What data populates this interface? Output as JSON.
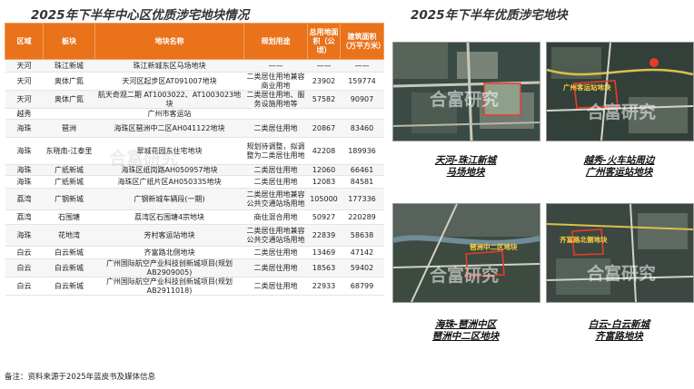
{
  "left_title": "2025年下半年中心区优质涉宅地块情况",
  "right_title": "2025年下半年优质涉宅地块",
  "table": {
    "headers": [
      "区域",
      "板块",
      "地块名称",
      "规划用途",
      "总用地面积（公顷）",
      "建筑面积（万平方米）"
    ],
    "rows": [
      [
        "天河",
        "珠江新城",
        "珠江新城东区马场地块",
        "——",
        "——",
        "——"
      ],
      [
        "天河",
        "奥体广氮",
        "天河区起步区AT091007地块",
        "二类居住用地兼容商业用地",
        "23902",
        "159774"
      ],
      [
        "天河",
        "奥体广氮",
        "航天奇观二期 AT1003022、AT1003023地块",
        "二类居住用地、服务设施用地等",
        "57582",
        "90907"
      ],
      [
        "越秀",
        "",
        "广州市客运站",
        "",
        "",
        ""
      ],
      [
        "海珠",
        "琶洲",
        "海珠区琶洲中二区AH041122地块",
        "二类居住用地",
        "20867",
        "83460"
      ],
      [
        "海珠",
        "东晓南-江泰里",
        "翠城花园东住宅地块",
        "规划待调整，拟调整为二类居住用地",
        "42208",
        "189936"
      ],
      [
        "海珠",
        "广纸新城",
        "海珠区纸岗路AH050957地块",
        "二类居住用地",
        "12060",
        "66461"
      ],
      [
        "海珠",
        "广纸新城",
        "海珠区广纸片区AH050335地块",
        "二类居住用地",
        "12083",
        "84581"
      ],
      [
        "荔湾",
        "广钢新城",
        "广钢新城车辆段(一期)",
        "二类居住用地兼容公共交通站场用地",
        "105000",
        "177336"
      ],
      [
        "荔湾",
        "石围塘",
        "荔湾区石围塘4宗地块",
        "商住混合用地",
        "50927",
        "220289"
      ],
      [
        "海珠",
        "花地湾",
        "芳村客运站地块",
        "二类居住用地兼容公共交通站场用地",
        "22839",
        "58638"
      ],
      [
        "白云",
        "白云新城",
        "齐富路北侧地块",
        "二类居住用地",
        "13469",
        "47142"
      ],
      [
        "白云",
        "白云新城",
        "广州国际航空产业科技创新城项目(规划 AB2909005)",
        "二类居住用地",
        "18563",
        "59402"
      ],
      [
        "白云",
        "白云新城",
        "广州国际航空产业科技创新城项目(规划 AB2911018)",
        "二类居住用地",
        "22933",
        "68799"
      ]
    ],
    "duplicate_row_value": "20867 83460"
  },
  "watermark": "合富研究",
  "maps": [
    {
      "caption_line1": "天河-珠江新城",
      "caption_line2": "马场地块",
      "label": ""
    },
    {
      "caption_line1": "越秀-火车站周边",
      "caption_line2": "广州客运站地块",
      "label": "广州客运站地块"
    },
    {
      "caption_line1": "海珠-琶洲中区",
      "caption_line2": "琶洲中二区地块",
      "label": "琶洲中二区地块"
    },
    {
      "caption_line1": "白云-白云新城",
      "caption_line2": "齐富路地块",
      "label": "齐富路北侧地块"
    }
  ],
  "map_place_labels": [
    "白云",
    "天河",
    "荔湾",
    "海珠",
    "越秀",
    "广州火车站",
    "流花湖",
    "西关",
    "环市"
  ],
  "note": "备注：资料来源于2025年蓝皮书及媒体信息",
  "colors": {
    "header_bg": "#e9721b",
    "highlight": "#e63c2a",
    "map_dark": "#2e3a33"
  }
}
